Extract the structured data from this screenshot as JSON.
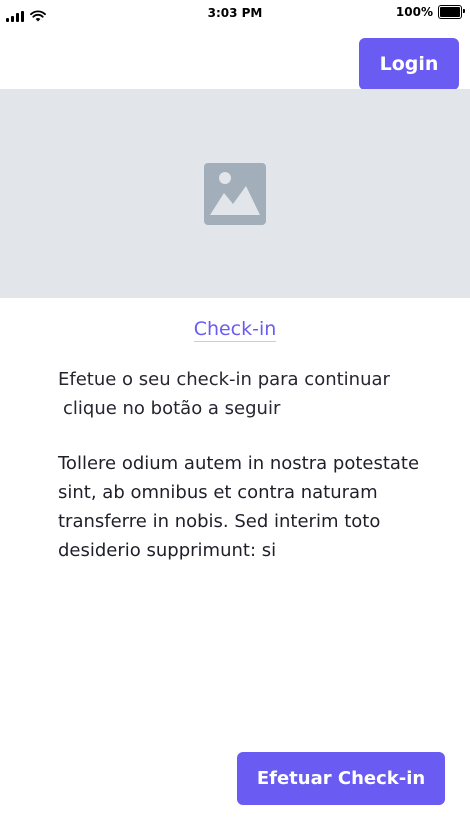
{
  "status_bar": {
    "time": "3:03 PM",
    "battery": "100%"
  },
  "header": {
    "login_label": "Login"
  },
  "hero": {
    "icon": "image-placeholder-icon"
  },
  "content": {
    "link_label": "Check-in",
    "intro_line1": "Efetue o seu check-in para continuar",
    "intro_line2": "clique no botão a seguir",
    "body": "Tollere odium autem in nostra potestate sint, ab omnibus et contra naturam transferre in nobis. Sed interim toto desiderio supprimunt: si"
  },
  "footer": {
    "cta_label": "Efetuar Check-in"
  },
  "colors": {
    "accent": "#6a5cf2",
    "hero_bg": "#e2e6ea",
    "placeholder_icon": "#a2aeba"
  }
}
